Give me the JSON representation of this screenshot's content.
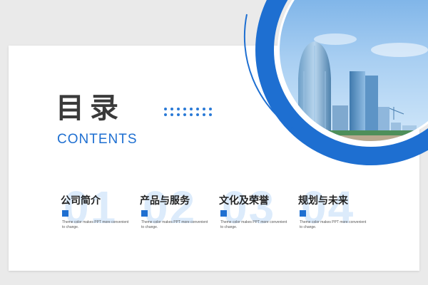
{
  "slide": {
    "title": "目录",
    "subtitle": "CONTENTS",
    "accent_color": "#1e6fd1"
  },
  "items": [
    {
      "number": "01",
      "title": "公司简介",
      "desc": "Theme color makes PPT more convenient to change."
    },
    {
      "number": "02",
      "title": "产品与服务",
      "desc": "Theme color makes PPT more convenient to change."
    },
    {
      "number": "03",
      "title": "文化及荣誉",
      "desc": "Theme color makes PPT more convenient to change."
    },
    {
      "number": "04",
      "title": "规划与未来",
      "desc": "Theme color makes PPT more convenient to change."
    }
  ]
}
